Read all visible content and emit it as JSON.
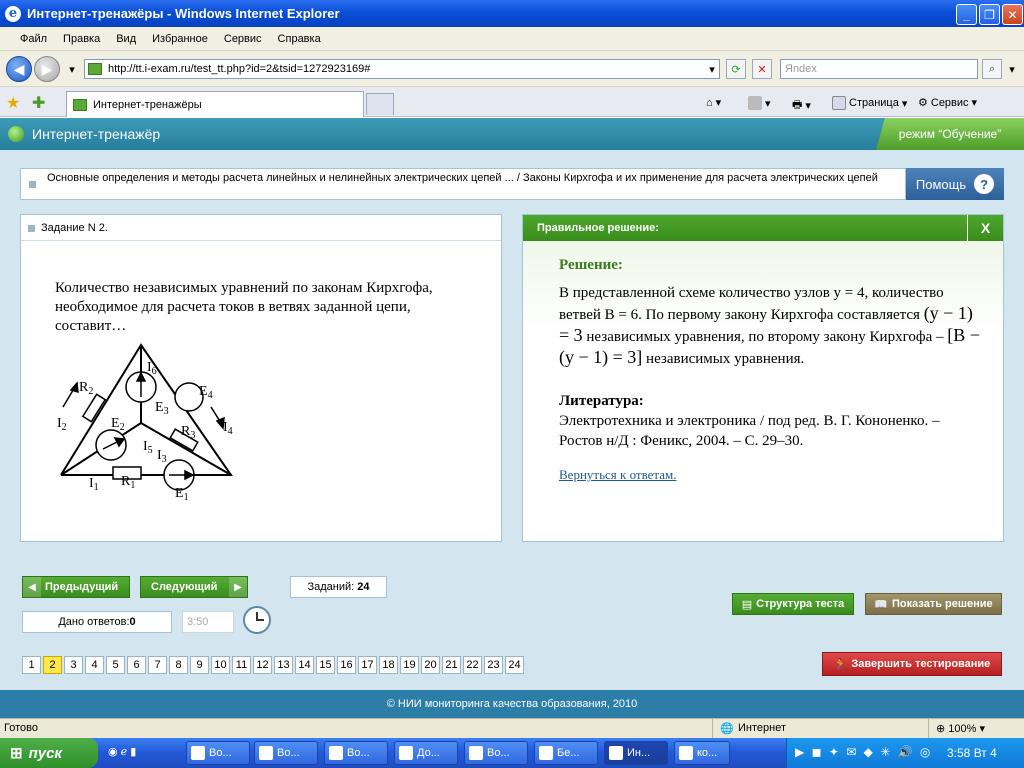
{
  "window": {
    "title": "Интернет-тренажёры - Windows Internet Explorer"
  },
  "menu": [
    "Файл",
    "Правка",
    "Вид",
    "Избранное",
    "Сервис",
    "Справка"
  ],
  "address": {
    "url": "http://tt.i-exam.ru/test_tt.php?id=2&tsid=1272923169#",
    "search_placeholder": "Яndex"
  },
  "tabs": {
    "active": "Интернет-тренажёры"
  },
  "toolbar": {
    "page": "Страница",
    "service": "Сервис"
  },
  "app": {
    "title": "Интернет-тренажёр",
    "mode": "режим “Обучение”",
    "help": "Помощь",
    "help_q": "?"
  },
  "breadcrumb": "Основные определения и методы расчета линейных и нелинейных электрических цепей ... / Законы Кирхгофа и их применение для расчета электрических цепей",
  "task": {
    "header": "Задание N 2.",
    "question": "Количество независимых уравнений по законам Кирхгофа, необходимое для расчета токов в ветвях заданной цепи, составит…",
    "circuit_labels": {
      "r1": "R",
      "r1s": "1",
      "r2": "R",
      "r2s": "2",
      "r3": "R",
      "r3s": "3",
      "e1": "E",
      "e1s": "1",
      "e2": "E",
      "e2s": "2",
      "e3": "E",
      "e3s": "3",
      "e4": "E",
      "e4s": "4",
      "i1": "I",
      "i1s": "1",
      "i2": "I",
      "i2s": "2",
      "i3": "I",
      "i3s": "3",
      "i4": "I",
      "i4s": "4",
      "i5": "I",
      "i5s": "5",
      "i6": "I",
      "i6s": "6"
    }
  },
  "solution": {
    "header": "Правильное решение:",
    "close": "X",
    "label": "Решение:",
    "p1": "В представленной схеме количество узлов y = 4, количество ветвей В = 6. По первому закону Кирхгофа составляется",
    "f1": "(y − 1) = 3",
    "p2": "независимых уравнения, по второму закону Кирхгофа –",
    "f2": "[B − (y − 1) = 3]",
    "p3": "независимых уравнения.",
    "lit_label": "Литература:",
    "lit": "Электротехника и электроника / под ред. В. Г. Кононенко. – Ростов н/Д : Феникс, 2004. – С. 29–30.",
    "back": "Вернуться к ответам."
  },
  "controls": {
    "prev": "Предыдущий",
    "next": "Следующий",
    "tasks_label": "Заданий:",
    "tasks_count": "24",
    "answers_label": "Дано ответов:",
    "answers_count": "0",
    "timer": "3:50",
    "structure": "Структура теста",
    "show_solution": "Показать решение",
    "finish": "Завершить тестирование"
  },
  "pages": [
    "1",
    "2",
    "3",
    "4",
    "5",
    "6",
    "7",
    "8",
    "9",
    "10",
    "11",
    "12",
    "13",
    "14",
    "15",
    "16",
    "17",
    "18",
    "19",
    "20",
    "21",
    "22",
    "23",
    "24"
  ],
  "footer": "© НИИ мониторинга качества образования, 2010",
  "statusbar": {
    "left": "Готово",
    "zone": "Интернет",
    "zoom": "100%"
  },
  "taskbar": {
    "start": "пуск",
    "items": [
      "Во...",
      "Во...",
      "Во...",
      "До...",
      "Во...",
      "Бе...",
      "Ин...",
      "ко..."
    ],
    "clock": "3:58 Вт 4"
  }
}
